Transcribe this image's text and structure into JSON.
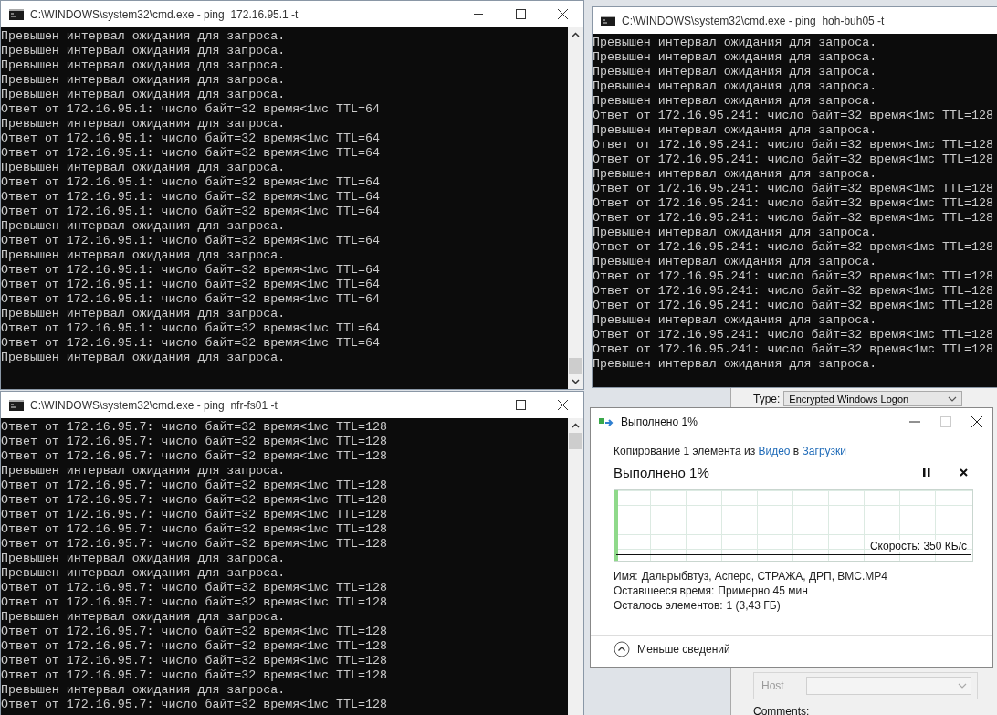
{
  "consoles": [
    {
      "title": "C:\\WINDOWS\\system32\\cmd.exe - ping  172.16.95.1 -t",
      "lines": [
        "Превышен интервал ожидания для запроса.",
        "Превышен интервал ожидания для запроса.",
        "Превышен интервал ожидания для запроса.",
        "Превышен интервал ожидания для запроса.",
        "Превышен интервал ожидания для запроса.",
        "Ответ от 172.16.95.1: число байт=32 время<1мс TTL=64",
        "Превышен интервал ожидания для запроса.",
        "Ответ от 172.16.95.1: число байт=32 время<1мс TTL=64",
        "Ответ от 172.16.95.1: число байт=32 время<1мс TTL=64",
        "Превышен интервал ожидания для запроса.",
        "Ответ от 172.16.95.1: число байт=32 время<1мс TTL=64",
        "Ответ от 172.16.95.1: число байт=32 время<1мс TTL=64",
        "Ответ от 172.16.95.1: число байт=32 время<1мс TTL=64",
        "Превышен интервал ожидания для запроса.",
        "Ответ от 172.16.95.1: число байт=32 время<1мс TTL=64",
        "Превышен интервал ожидания для запроса.",
        "Ответ от 172.16.95.1: число байт=32 время<1мс TTL=64",
        "Ответ от 172.16.95.1: число байт=32 время<1мс TTL=64",
        "Ответ от 172.16.95.1: число байт=32 время<1мс TTL=64",
        "Превышен интервал ожидания для запроса.",
        "Ответ от 172.16.95.1: число байт=32 время<1мс TTL=64",
        "Ответ от 172.16.95.1: число байт=32 время<1мс TTL=64",
        "Превышен интервал ожидания для запроса."
      ]
    },
    {
      "title": "C:\\WINDOWS\\system32\\cmd.exe - ping  hoh-buh05 -t",
      "lines": [
        "Превышен интервал ожидания для запроса.",
        "Превышен интервал ожидания для запроса.",
        "Превышен интервал ожидания для запроса.",
        "Превышен интервал ожидания для запроса.",
        "Превышен интервал ожидания для запроса.",
        "Ответ от 172.16.95.241: число байт=32 время<1мс TTL=128",
        "Превышен интервал ожидания для запроса.",
        "Ответ от 172.16.95.241: число байт=32 время<1мс TTL=128",
        "Ответ от 172.16.95.241: число байт=32 время<1мс TTL=128",
        "Превышен интервал ожидания для запроса.",
        "Ответ от 172.16.95.241: число байт=32 время<1мс TTL=128",
        "Ответ от 172.16.95.241: число байт=32 время<1мс TTL=128",
        "Ответ от 172.16.95.241: число байт=32 время<1мс TTL=128",
        "Превышен интервал ожидания для запроса.",
        "Ответ от 172.16.95.241: число байт=32 время<1мс TTL=128",
        "Превышен интервал ожидания для запроса.",
        "Ответ от 172.16.95.241: число байт=32 время<1мс TTL=128",
        "Ответ от 172.16.95.241: число байт=32 время<1мс TTL=128",
        "Ответ от 172.16.95.241: число байт=32 время<1мс TTL=128",
        "Превышен интервал ожидания для запроса.",
        "Ответ от 172.16.95.241: число байт=32 время<1мс TTL=128",
        "Ответ от 172.16.95.241: число байт=32 время<1мс TTL=128",
        "Превышен интервал ожидания для запроса."
      ]
    },
    {
      "title": "C:\\WINDOWS\\system32\\cmd.exe - ping  nfr-fs01 -t",
      "lines": [
        "Ответ от 172.16.95.7: число байт=32 время<1мс TTL=128",
        "Ответ от 172.16.95.7: число байт=32 время<1мс TTL=128",
        "Ответ от 172.16.95.7: число байт=32 время<1мс TTL=128",
        "Превышен интервал ожидания для запроса.",
        "Ответ от 172.16.95.7: число байт=32 время<1мс TTL=128",
        "Ответ от 172.16.95.7: число байт=32 время<1мс TTL=128",
        "Ответ от 172.16.95.7: число байт=32 время<1мс TTL=128",
        "Ответ от 172.16.95.7: число байт=32 время<1мс TTL=128",
        "Ответ от 172.16.95.7: число байт=32 время<1мс TTL=128",
        "Превышен интервал ожидания для запроса.",
        "Превышен интервал ожидания для запроса.",
        "Ответ от 172.16.95.7: число байт=32 время<1мс TTL=128",
        "Ответ от 172.16.95.7: число байт=32 время<1мс TTL=128",
        "Превышен интервал ожидания для запроса.",
        "Ответ от 172.16.95.7: число байт=32 время<1мс TTL=128",
        "Ответ от 172.16.95.7: число байт=32 время<1мс TTL=128",
        "Ответ от 172.16.95.7: число байт=32 время<1мс TTL=128",
        "Ответ от 172.16.95.7: число байт=32 время<1мс TTL=128",
        "Превышен интервал ожидания для запроса.",
        "Ответ от 172.16.95.7: число байт=32 время<1мс TTL=128"
      ]
    }
  ],
  "background_window": {
    "type_label": "Type:",
    "type_value": "Encrypted Windows Logon",
    "host": {
      "label": "Host",
      "disabled": true
    },
    "comments_label": "Comments:"
  },
  "copy_dialog": {
    "title": "Выполнено 1%",
    "description": {
      "before": "Копирование 1 элемента из ",
      "source": "Видео",
      "middle": " в ",
      "target": "Загрузки"
    },
    "heading": "Выполнено 1%",
    "progress": {
      "level": 0.01
    },
    "speed": "Скорость: 350 КБ/с",
    "details": [
      {
        "label": "Имя:",
        "value": "Дальрыбвтуз, Асперс, СТРАЖА, ДРП, ВМС.MP4"
      },
      {
        "label": "Оставшееся время:",
        "value": "Примерно 45 мин"
      },
      {
        "label": "Осталось элементов:",
        "value": "1 (3,43 ГБ)"
      }
    ],
    "toggle": "Меньше сведений"
  }
}
